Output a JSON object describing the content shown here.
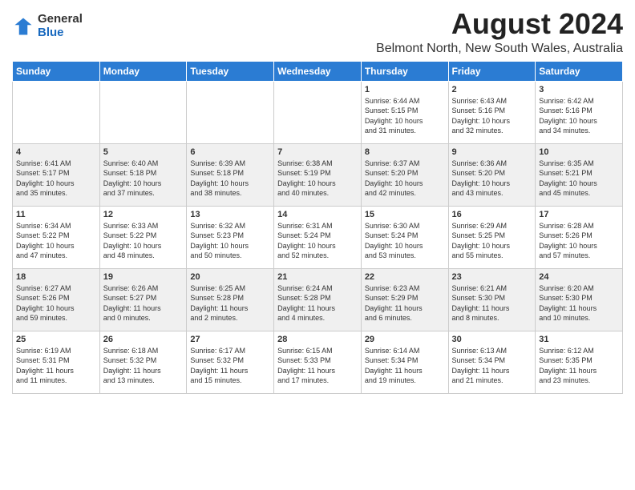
{
  "header": {
    "logo": {
      "general": "General",
      "blue": "Blue"
    },
    "title": "August 2024",
    "location": "Belmont North, New South Wales, Australia"
  },
  "weekdays": [
    "Sunday",
    "Monday",
    "Tuesday",
    "Wednesday",
    "Thursday",
    "Friday",
    "Saturday"
  ],
  "weeks": [
    [
      {
        "day": "",
        "info": ""
      },
      {
        "day": "",
        "info": ""
      },
      {
        "day": "",
        "info": ""
      },
      {
        "day": "",
        "info": ""
      },
      {
        "day": "1",
        "info": "Sunrise: 6:44 AM\nSunset: 5:15 PM\nDaylight: 10 hours\nand 31 minutes."
      },
      {
        "day": "2",
        "info": "Sunrise: 6:43 AM\nSunset: 5:16 PM\nDaylight: 10 hours\nand 32 minutes."
      },
      {
        "day": "3",
        "info": "Sunrise: 6:42 AM\nSunset: 5:16 PM\nDaylight: 10 hours\nand 34 minutes."
      }
    ],
    [
      {
        "day": "4",
        "info": "Sunrise: 6:41 AM\nSunset: 5:17 PM\nDaylight: 10 hours\nand 35 minutes."
      },
      {
        "day": "5",
        "info": "Sunrise: 6:40 AM\nSunset: 5:18 PM\nDaylight: 10 hours\nand 37 minutes."
      },
      {
        "day": "6",
        "info": "Sunrise: 6:39 AM\nSunset: 5:18 PM\nDaylight: 10 hours\nand 38 minutes."
      },
      {
        "day": "7",
        "info": "Sunrise: 6:38 AM\nSunset: 5:19 PM\nDaylight: 10 hours\nand 40 minutes."
      },
      {
        "day": "8",
        "info": "Sunrise: 6:37 AM\nSunset: 5:20 PM\nDaylight: 10 hours\nand 42 minutes."
      },
      {
        "day": "9",
        "info": "Sunrise: 6:36 AM\nSunset: 5:20 PM\nDaylight: 10 hours\nand 43 minutes."
      },
      {
        "day": "10",
        "info": "Sunrise: 6:35 AM\nSunset: 5:21 PM\nDaylight: 10 hours\nand 45 minutes."
      }
    ],
    [
      {
        "day": "11",
        "info": "Sunrise: 6:34 AM\nSunset: 5:22 PM\nDaylight: 10 hours\nand 47 minutes."
      },
      {
        "day": "12",
        "info": "Sunrise: 6:33 AM\nSunset: 5:22 PM\nDaylight: 10 hours\nand 48 minutes."
      },
      {
        "day": "13",
        "info": "Sunrise: 6:32 AM\nSunset: 5:23 PM\nDaylight: 10 hours\nand 50 minutes."
      },
      {
        "day": "14",
        "info": "Sunrise: 6:31 AM\nSunset: 5:24 PM\nDaylight: 10 hours\nand 52 minutes."
      },
      {
        "day": "15",
        "info": "Sunrise: 6:30 AM\nSunset: 5:24 PM\nDaylight: 10 hours\nand 53 minutes."
      },
      {
        "day": "16",
        "info": "Sunrise: 6:29 AM\nSunset: 5:25 PM\nDaylight: 10 hours\nand 55 minutes."
      },
      {
        "day": "17",
        "info": "Sunrise: 6:28 AM\nSunset: 5:26 PM\nDaylight: 10 hours\nand 57 minutes."
      }
    ],
    [
      {
        "day": "18",
        "info": "Sunrise: 6:27 AM\nSunset: 5:26 PM\nDaylight: 10 hours\nand 59 minutes."
      },
      {
        "day": "19",
        "info": "Sunrise: 6:26 AM\nSunset: 5:27 PM\nDaylight: 11 hours\nand 0 minutes."
      },
      {
        "day": "20",
        "info": "Sunrise: 6:25 AM\nSunset: 5:28 PM\nDaylight: 11 hours\nand 2 minutes."
      },
      {
        "day": "21",
        "info": "Sunrise: 6:24 AM\nSunset: 5:28 PM\nDaylight: 11 hours\nand 4 minutes."
      },
      {
        "day": "22",
        "info": "Sunrise: 6:23 AM\nSunset: 5:29 PM\nDaylight: 11 hours\nand 6 minutes."
      },
      {
        "day": "23",
        "info": "Sunrise: 6:21 AM\nSunset: 5:30 PM\nDaylight: 11 hours\nand 8 minutes."
      },
      {
        "day": "24",
        "info": "Sunrise: 6:20 AM\nSunset: 5:30 PM\nDaylight: 11 hours\nand 10 minutes."
      }
    ],
    [
      {
        "day": "25",
        "info": "Sunrise: 6:19 AM\nSunset: 5:31 PM\nDaylight: 11 hours\nand 11 minutes."
      },
      {
        "day": "26",
        "info": "Sunrise: 6:18 AM\nSunset: 5:32 PM\nDaylight: 11 hours\nand 13 minutes."
      },
      {
        "day": "27",
        "info": "Sunrise: 6:17 AM\nSunset: 5:32 PM\nDaylight: 11 hours\nand 15 minutes."
      },
      {
        "day": "28",
        "info": "Sunrise: 6:15 AM\nSunset: 5:33 PM\nDaylight: 11 hours\nand 17 minutes."
      },
      {
        "day": "29",
        "info": "Sunrise: 6:14 AM\nSunset: 5:34 PM\nDaylight: 11 hours\nand 19 minutes."
      },
      {
        "day": "30",
        "info": "Sunrise: 6:13 AM\nSunset: 5:34 PM\nDaylight: 11 hours\nand 21 minutes."
      },
      {
        "day": "31",
        "info": "Sunrise: 6:12 AM\nSunset: 5:35 PM\nDaylight: 11 hours\nand 23 minutes."
      }
    ]
  ]
}
